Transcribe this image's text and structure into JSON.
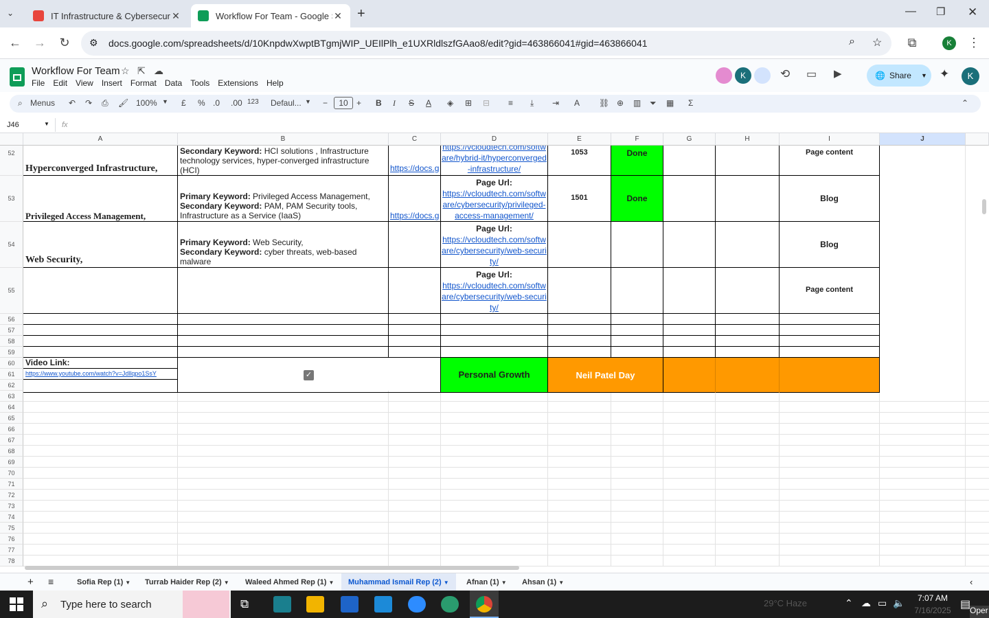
{
  "browser": {
    "tabs": [
      {
        "title": "IT Infrastructure & Cybersecurit",
        "active": false
      },
      {
        "title": "Workflow For Team - Google Sh",
        "active": true
      }
    ],
    "url": "docs.google.com/spreadsheets/d/10KnpdwXwptBTgmjWIP_UEIlPlh_e1UXRldlszfGAao8/edit?gid=463866041#gid=463866041"
  },
  "sheet": {
    "title": "Workflow For Team",
    "menu": [
      "File",
      "Edit",
      "View",
      "Insert",
      "Format",
      "Data",
      "Tools",
      "Extensions",
      "Help"
    ],
    "share_label": "Share",
    "avatar_letter": "K",
    "toolbar": {
      "menus_label": "Menus",
      "zoom": "100%",
      "currency": "£",
      "percent": "%",
      "dec_down": ".0",
      "dec_up": ".00",
      "number_format": "123",
      "font": "Defaul...",
      "font_size": "10"
    },
    "name_box": "J46",
    "fx": "fx"
  },
  "grid": {
    "columns": [
      "A",
      "B",
      "C",
      "D",
      "E",
      "F",
      "G",
      "H",
      "I",
      "J"
    ],
    "row_numbers": [
      "52",
      "53",
      "54",
      "55",
      "56",
      "57",
      "58",
      "59",
      "60",
      "61",
      "62",
      "63",
      "64",
      "65",
      "66",
      "67",
      "68",
      "69",
      "70",
      "71",
      "72",
      "73",
      "74",
      "75",
      "76",
      "77",
      "78"
    ],
    "rows": {
      "r52": {
        "a": "Hyperconverged Infrastructure,",
        "b_label": "Secondary Keyword:",
        "b_text": " HCI solutions , Infrastructure technology services, hyper-converged infrastructure (HCI)",
        "c": "https://docs.g",
        "d": "https://vcloudtech.com/software/hybrid-it/hyperconverged-infrastructure/",
        "e": "1053",
        "f": "Done",
        "i": "Page content"
      },
      "r53": {
        "a": "Privileged Access Management,",
        "b_label1": "Primary Keyword:",
        "b_text1": " Privileged Access Management,",
        "b_label2": "Secondary Keyword:",
        "b_text2": " PAM, PAM Security tools, Infrastructure as a Service (IaaS)",
        "c": "https://docs.g",
        "d_label": "Page Url:",
        "d": "https://vcloudtech.com/software/cybersecurity/privileged-access-management/",
        "e": "1501",
        "f": "Done",
        "i": "Blog"
      },
      "r54": {
        "a": "Web Security,",
        "b_label1": "Primary Keyword:",
        "b_text1": " Web Security,",
        "b_label2": "Secondary Keyword:",
        "b_text2": " cyber threats, web-based malware",
        "d_label": "Page Url:",
        "d": "https://vcloudtech.com/software/cybersecurity/web-security/",
        "i": "Blog"
      },
      "r55": {
        "d_label": "Page Url:",
        "d": "https://vcloudtech.com/software/cybersecurity/web-security/",
        "i": "Page content"
      },
      "r60": {
        "a": "Video Link:",
        "a61": "https://www.youtube.com/watch?v=Jdllqpo1SsY",
        "d": "Personal Growth",
        "e": "Neil Patel Day"
      }
    }
  },
  "sheet_tabs": [
    {
      "label": "Sofia Rep (1)",
      "active": false
    },
    {
      "label": "Turrab Haider Rep (2)",
      "active": false
    },
    {
      "label": "Waleed Ahmed Rep (1)",
      "active": false
    },
    {
      "label": "Muhammad Ismail Rep (2)",
      "active": true
    },
    {
      "label": "Afnan (1)",
      "active": false
    },
    {
      "label": "Ahsan (1)",
      "active": false
    }
  ],
  "taskbar": {
    "search_placeholder": "Type here to search",
    "weather": "29°C  Haze",
    "time": "7:07 AM",
    "date": "7/16/2025",
    "open_label": "Oper"
  },
  "colors": {
    "green": "#00ff00",
    "orange": "#ff9900",
    "link": "#1155cc",
    "sheets_green": "#0f9d58"
  }
}
